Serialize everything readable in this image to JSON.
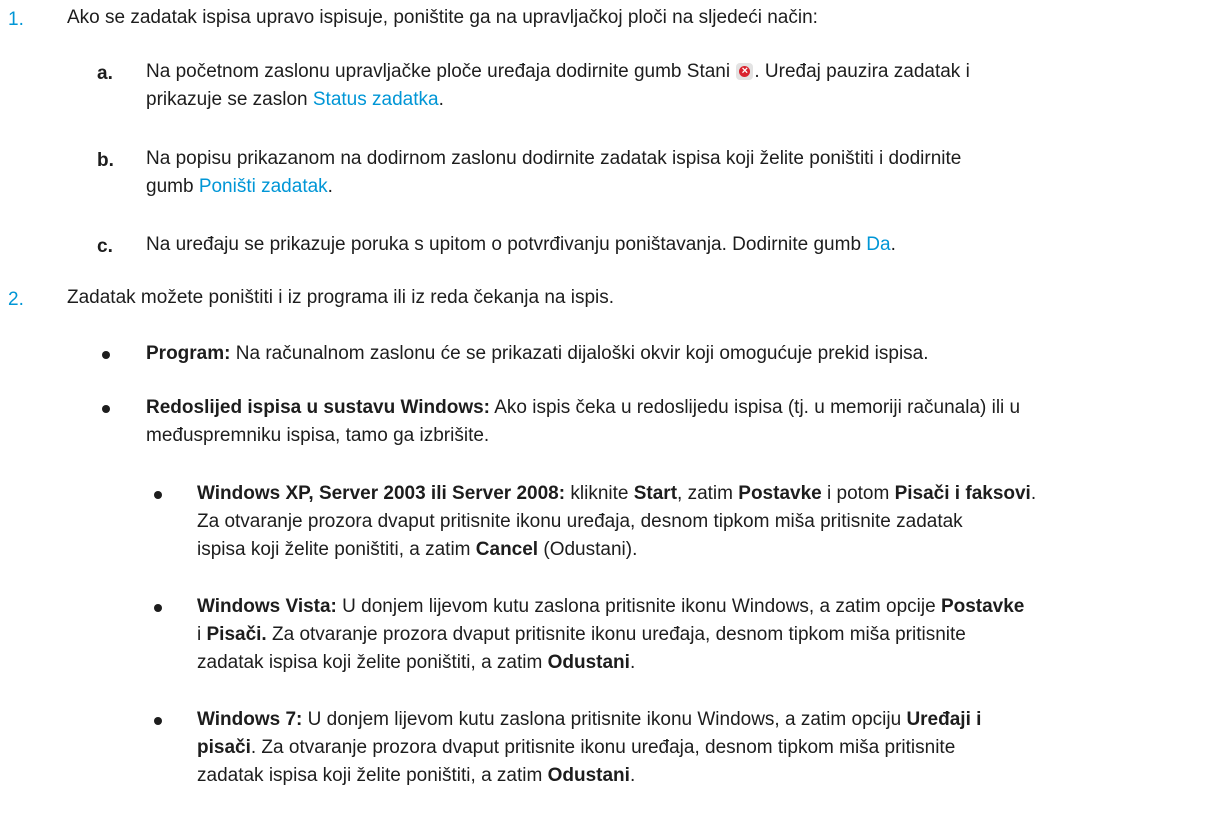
{
  "steps": [
    {
      "marker": "1.",
      "text": "Ako se zadatak ispisa upravo ispisuje, poništite ga na upravljačkoj ploči na sljedeći način:",
      "substeps": [
        {
          "marker": "a.",
          "text_1": "Na početnom zaslonu upravljačke ploče uređaja dodirnite gumb Stani",
          "text_2": ". Uređaj pauzira zadatak i",
          "text_3": "prikazuje se zaslon",
          "link": "Status zadatka",
          "text_4": "."
        },
        {
          "marker": "b.",
          "text_1": "Na popisu prikazanom na dodirnom zaslonu dodirnite zadatak ispisa koji želite poništiti i dodirnite",
          "text_2": "gumb",
          "link": "Poništi zadatak",
          "text_3": "."
        },
        {
          "marker": "c.",
          "text_1": "Na uređaju se prikazuje poruka s upitom o potvrđivanju poništavanja. Dodirnite gumb",
          "link": "Da",
          "text_2": "."
        }
      ]
    },
    {
      "marker": "2.",
      "text": "Zadatak možete poništiti i iz programa ili iz reda čekanja na ispis.",
      "bullets": [
        {
          "bold": "Program:",
          "text": " Na računalnom zaslonu će se prikazati dijaloški okvir koji omogućuje prekid ispisa."
        },
        {
          "bold": "Redoslijed ispisa u sustavu Windows:",
          "text_1": " Ako ispis čeka u redoslijedu ispisa (tj. u memoriji računala) ili u",
          "text_2": "međuspremniku ispisa, tamo ga izbrišite.",
          "sub_bullets": [
            {
              "bold": "Windows XP, Server 2003 ili Server 2008:",
              "t1": " kliknite ",
              "b1": "Start",
              "t2": ", zatim ",
              "b2": "Postavke",
              "t3": " i potom ",
              "b3": "Pisači i faksovi",
              "t4": ".",
              "line2": "Za otvaranje prozora dvaput pritisnite ikonu uređaja, desnom tipkom miša pritisnite zadatak",
              "line3_a": "ispisa koji želite poništiti, a zatim ",
              "line3_b": "Cancel",
              "line3_c": " (Odustani)."
            },
            {
              "bold": "Windows Vista:",
              "t1": " U donjem lijevom kutu zaslona pritisnite ikonu Windows, a zatim opcije ",
              "b1": "Postavke",
              "line2_a": "i ",
              "line2_b": "Pisači.",
              "line2_c": " Za otvaranje prozora dvaput pritisnite ikonu uređaja, desnom tipkom miša pritisnite",
              "line3_a": "zadatak ispisa koji želite poništiti, a zatim ",
              "line3_b": "Odustani",
              "line3_c": "."
            },
            {
              "bold": "Windows 7:",
              "t1": " U donjem lijevom kutu zaslona pritisnite ikonu Windows, a zatim opciju ",
              "b1": "Uređaji i",
              "line2_a": "pisači",
              "line2_b": ". Za otvaranje prozora dvaput pritisnite ikonu uređaja, desnom tipkom miša pritisnite",
              "line3_a": "zadatak ispisa koji želite poništiti, a zatim ",
              "line3_b": "Odustani",
              "line3_c": "."
            }
          ]
        }
      ]
    }
  ]
}
